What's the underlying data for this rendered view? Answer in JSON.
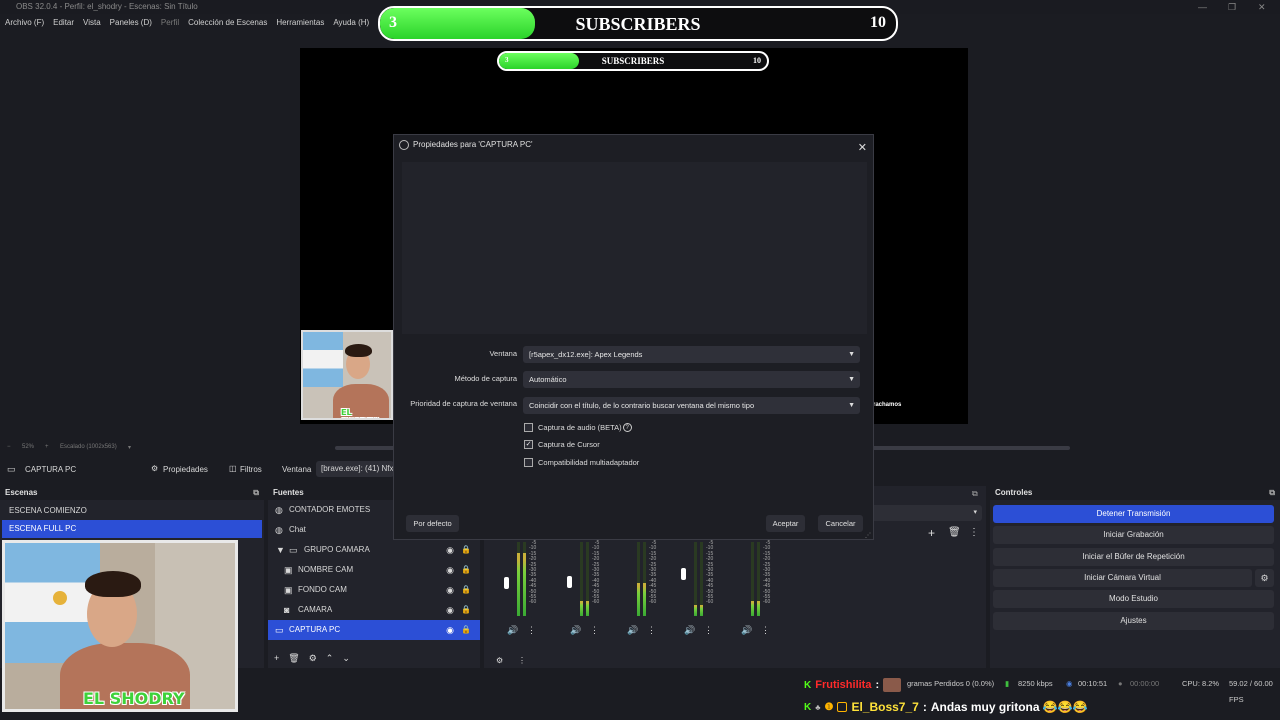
{
  "window": {
    "title": "OBS 32.0.4 - Perfil: el_shodry - Escenas: Sin Título",
    "controls": [
      "—",
      "❐",
      "✕"
    ]
  },
  "menu": [
    "Archivo (F)",
    "Editar",
    "Vista",
    "Paneles (D)",
    "Perfil",
    "Colección de Escenas",
    "Herramientas",
    "Ayuda (H)"
  ],
  "overlay": {
    "label": "SUBSCRIBERS",
    "current": "3",
    "goal": "10",
    "progress": 0.3
  },
  "preview_overlay": {
    "label": "SUBSCRIBERS",
    "current": "3",
    "goal": "10",
    "progress": 0.3
  },
  "preview": {
    "partial_text": "rachamos"
  },
  "cam_logo": "EL SHODRY",
  "zoom": {
    "level": "52%",
    "scale": "Escalado (1002x563)"
  },
  "source_toolbar": {
    "selected_source": "CAPTURA PC",
    "properties": "Propiedades",
    "filters": "Filtros",
    "window_label": "Ventana",
    "window_value": "[brave.exe]: (41) Nfx -"
  },
  "scenes": {
    "title": "Escenas",
    "items": [
      "ESCENA COMIENZO",
      "ESCENA FULL PC"
    ],
    "selected": 1
  },
  "sources": {
    "title": "Fuentes",
    "items": [
      {
        "label": "CONTADOR EMOTES",
        "icon": "globe-icon"
      },
      {
        "label": "Chat",
        "icon": "globe-icon"
      },
      {
        "label": "GRUPO CAMARA",
        "icon": "folder-icon"
      },
      {
        "label": "NOMBRE CAM",
        "icon": "image-icon"
      },
      {
        "label": "FONDO CAM",
        "icon": "image-icon"
      },
      {
        "label": "CAMARA",
        "icon": "camera-icon"
      },
      {
        "label": "CAPTURA PC",
        "icon": "monitor-icon"
      }
    ]
  },
  "mixer": {
    "scale": [
      "-5",
      "-10",
      "-15",
      "-20",
      "-25",
      "-30",
      "-35",
      "-40",
      "-45",
      "-50",
      "-55",
      "-60"
    ],
    "levels": [
      0.85,
      0.2,
      0.45,
      0.15,
      0.2
    ]
  },
  "controls": {
    "title": "Controles",
    "buttons": [
      "Detener Transmisión",
      "Iniciar Grabación",
      "Iniciar el Búfer de Repetición",
      "Iniciar Cámara Virtual",
      "Modo Estudio",
      "Ajustes"
    ]
  },
  "dialog": {
    "title": "Propiedades para 'CAPTURA PC'",
    "fields": [
      {
        "label": "Ventana",
        "value": "[r5apex_dx12.exe]: Apex Legends"
      },
      {
        "label": "Método de captura",
        "value": "Automático"
      },
      {
        "label": "Prioridad de captura de ventana",
        "value": "Coincidir con el título, de lo contrario buscar ventana del mismo tipo"
      }
    ],
    "checkboxes": [
      {
        "label": "Captura de audio (BETA)",
        "checked": false
      },
      {
        "label": "Captura de Cursor",
        "checked": true
      },
      {
        "label": "Compatibilidad multiadaptador",
        "checked": false
      }
    ],
    "defaults_button": "Por defecto",
    "ok_button": "Aceptar",
    "cancel_button": "Cancelar"
  },
  "status": {
    "dropped": "gramas Perdidos 0 (0.0%)",
    "bitrate": "8250 kbps",
    "stream_time": "00:10:51",
    "rec_time": "00:00:00",
    "cpu": "CPU: 8.2%",
    "fps": "59.02 / 60.00 FPS"
  },
  "chat": [
    {
      "user": "Frutishilita",
      "sep": ":",
      "message": ""
    },
    {
      "user": "El_Boss7_7",
      "sep": ":",
      "message": "Andas muy gritona 😂😂😂"
    }
  ],
  "colors": {
    "accent": "#2c4fd6",
    "overlay_green": "#39e035",
    "chat_green": "#53fc18",
    "chat_user_red": "#ff2a2a",
    "chat_user_yellow": "#ffe23a"
  }
}
